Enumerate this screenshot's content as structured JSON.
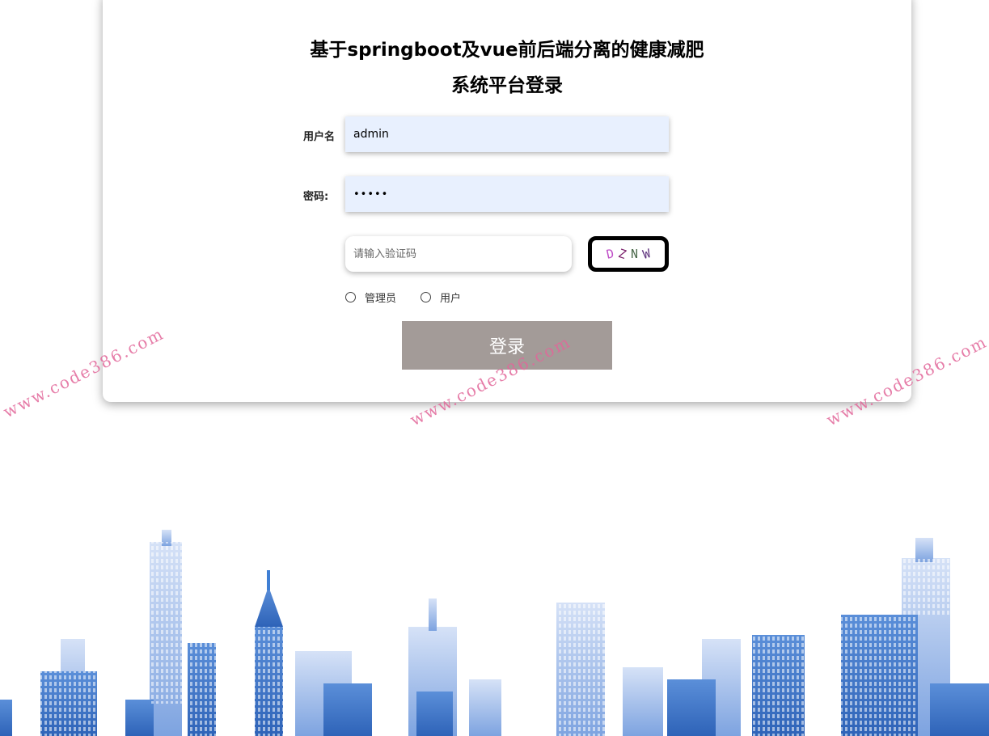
{
  "title": {
    "line1": "基于springboot及vue前后端分离的健康减肥",
    "line2": "系统平台登录"
  },
  "form": {
    "username_label": "用户名",
    "username_value": "admin",
    "password_label": "密码:",
    "password_value": "•••••",
    "captcha_placeholder": "请输入验证码",
    "captcha_chars": [
      "D",
      "Z",
      "N",
      "W"
    ],
    "captcha_colors": [
      "#c04fc8",
      "#7a1f6b",
      "#4d6b4d",
      "#5a2e7a"
    ],
    "roles": [
      "管理员",
      "用户"
    ],
    "login_button": "登录"
  },
  "watermark": {
    "text": "www.code386.com",
    "color": "#e2679a"
  },
  "colors": {
    "input_bg": "#e8f0fe",
    "button_bg": "#a39b98",
    "skyline_blue": "#3f7fd4"
  }
}
